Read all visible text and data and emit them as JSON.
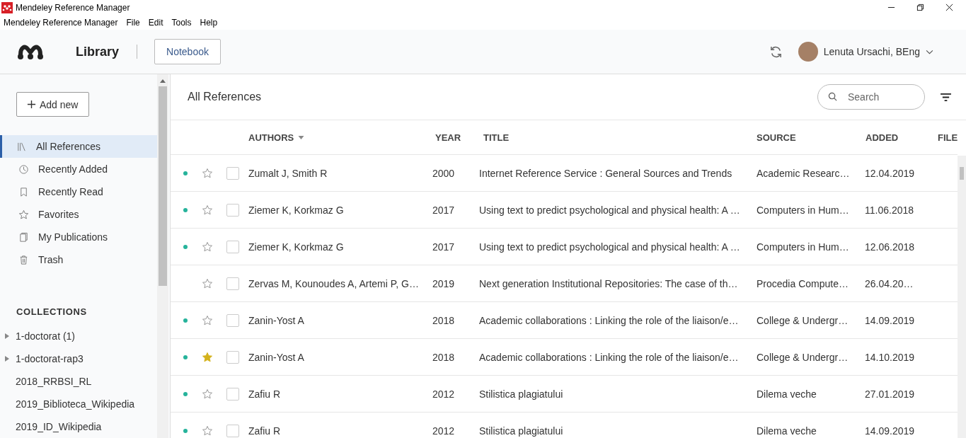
{
  "window": {
    "title": "Mendeley Reference Manager"
  },
  "menu": [
    "Mendeley Reference Manager",
    "File",
    "Edit",
    "Tools",
    "Help"
  ],
  "header": {
    "section": "Library",
    "notebook_button": "Notebook",
    "user": "Lenuta Ursachi, BEng"
  },
  "sidebar": {
    "add_button": "Add new",
    "items": [
      {
        "label": "All References",
        "kind": "library",
        "selected": true
      },
      {
        "label": "Recently Added",
        "kind": "clock",
        "selected": false
      },
      {
        "label": "Recently Read",
        "kind": "bookmark",
        "selected": false
      },
      {
        "label": "Favorites",
        "kind": "star",
        "selected": false
      },
      {
        "label": "My Publications",
        "kind": "publications",
        "selected": false
      },
      {
        "label": "Trash",
        "kind": "trash",
        "selected": false
      }
    ],
    "collections_heading": "COLLECTIONS",
    "collections": [
      {
        "label": "1-doctorat (1)",
        "expandable": true
      },
      {
        "label": "1-doctorat-rap3",
        "expandable": true
      },
      {
        "label": "2018_RRBSI_RL",
        "expandable": false
      },
      {
        "label": "2019_Biblioteca_Wikipedia",
        "expandable": false
      },
      {
        "label": "2019_ID_Wikipedia",
        "expandable": false
      }
    ]
  },
  "main": {
    "heading": "All References",
    "search": {
      "placeholder": "Search"
    },
    "table": {
      "columns": [
        "AUTHORS",
        "YEAR",
        "TITLE",
        "SOURCE",
        "ADDED",
        "FILE"
      ],
      "rows": [
        {
          "unread": true,
          "starred": false,
          "checked": false,
          "authors": "Zumalt J, Smith R",
          "year": "2000",
          "title": "Internet Reference Service : General Sources and Trends",
          "source": "Academic Researc…",
          "added": "12.04.2019"
        },
        {
          "unread": true,
          "starred": false,
          "checked": false,
          "authors": "Ziemer K, Korkmaz G",
          "year": "2017",
          "title": "Using text to predict psychological and physical health: A …",
          "source": "Computers in Hum…",
          "added": "11.06.2018"
        },
        {
          "unread": true,
          "starred": false,
          "checked": false,
          "authors": "Ziemer K, Korkmaz G",
          "year": "2017",
          "title": "Using text to predict psychological and physical health: A …",
          "source": "Computers in Hum…",
          "added": "12.06.2018"
        },
        {
          "unread": false,
          "starred": false,
          "checked": false,
          "authors": "Zervas M, Kounoudes A, Artemi P, G…",
          "year": "2019",
          "title": "Next generation Institutional Repositories: The case of th…",
          "source": "Procedia Compute…",
          "added": "26.04.20…"
        },
        {
          "unread": true,
          "starred": false,
          "checked": false,
          "authors": "Zanin-Yost A",
          "year": "2018",
          "title": "Academic collaborations : Linking the role of the liaison/e…",
          "source": "College & Undergr…",
          "added": "14.09.2019"
        },
        {
          "unread": true,
          "starred": true,
          "checked": false,
          "authors": "Zanin-Yost A",
          "year": "2018",
          "title": "Academic collaborations : Linking the role of the liaison/e…",
          "source": "College & Undergr…",
          "added": "14.10.2019"
        },
        {
          "unread": true,
          "starred": false,
          "checked": false,
          "authors": "Zafiu R",
          "year": "2012",
          "title": "Stilistica plagiatului",
          "source": "Dilema veche",
          "added": "27.01.2019"
        },
        {
          "unread": true,
          "starred": false,
          "checked": false,
          "authors": "Zafiu R",
          "year": "2012",
          "title": "Stilistica plagiatului",
          "source": "Dilema veche",
          "added": "14.09.2019"
        }
      ]
    }
  }
}
